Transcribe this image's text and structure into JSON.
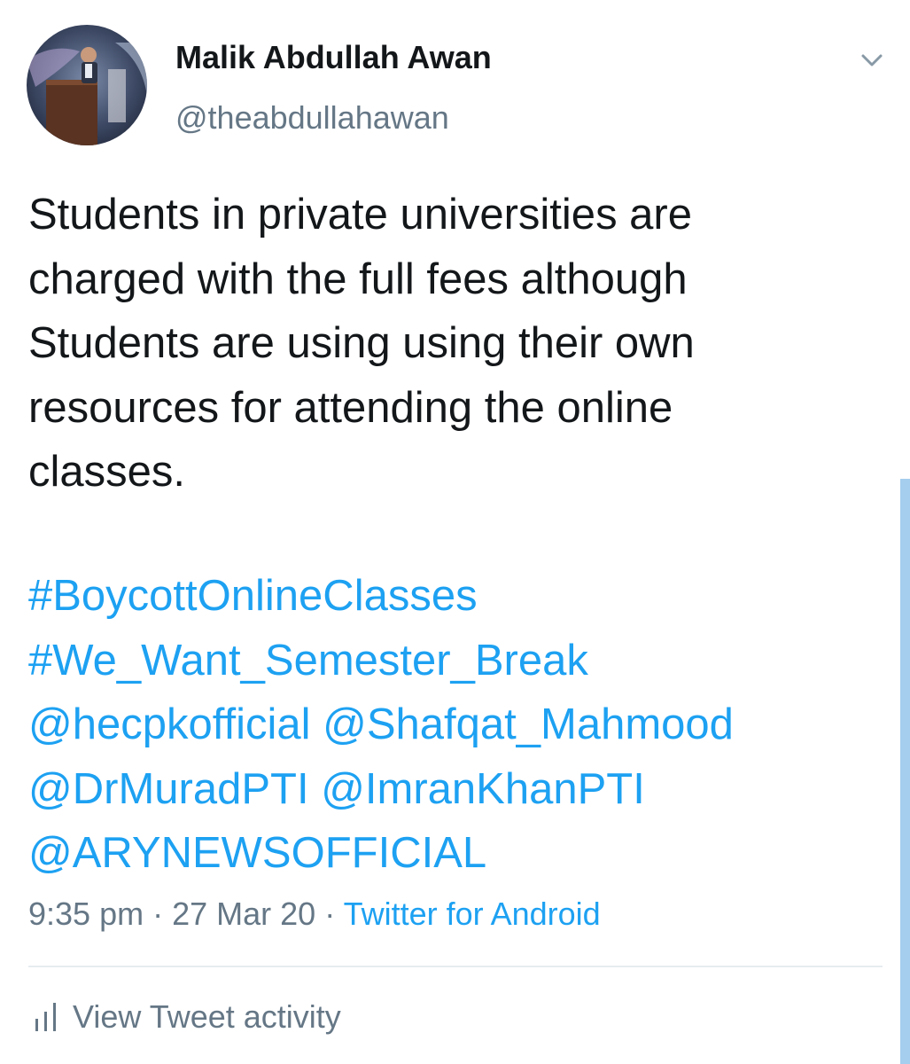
{
  "author": {
    "display_name": "Malik Abdullah Awan",
    "handle": "@theabdullahawan"
  },
  "tweet": {
    "text_lines": [
      "Students in private universities are",
      "charged with the full fees although",
      "Students are using using their own",
      "resources for attending the online",
      "classes."
    ],
    "hashtags": [
      "#BoycottOnlineClasses",
      "#We_Want_Semester_Break"
    ],
    "mentions": [
      "@hecpkofficial",
      "@Shafqat_Mahmood",
      "@DrMuradPTI",
      "@ImranKhanPTI",
      "@ARYNEWSOFFICIAL"
    ]
  },
  "meta": {
    "time": "9:35 pm",
    "separator": "·",
    "date": "27 Mar 20",
    "source": "Twitter for Android"
  },
  "actions": {
    "view_activity_label": "View Tweet activity"
  },
  "icons": {
    "menu": "chevron-down-icon",
    "activity": "stats-bars-icon"
  },
  "colors": {
    "link": "#1da1f2",
    "secondary_text": "#657786",
    "primary_text": "#14171a",
    "divider": "#e6ecf0",
    "scrollbar": "#a4cdee"
  }
}
